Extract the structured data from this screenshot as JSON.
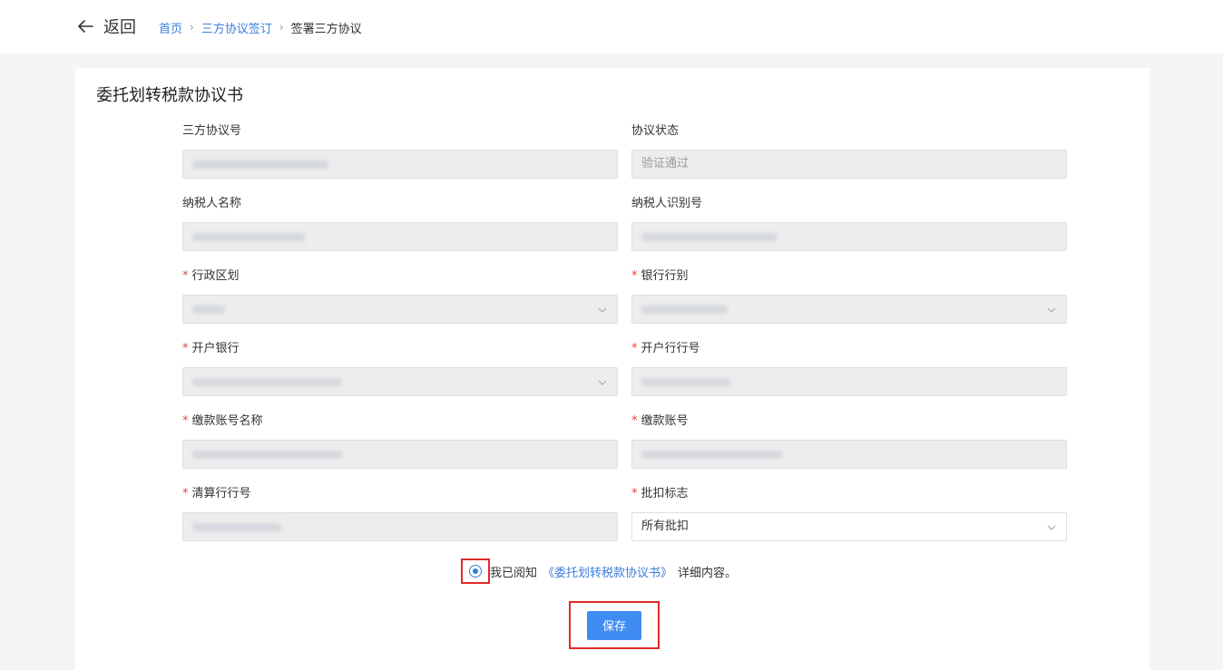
{
  "header": {
    "back_label": "返回",
    "breadcrumb": {
      "home": "首页",
      "section": "三方协议签订",
      "current": "签署三方协议"
    }
  },
  "form": {
    "title": "委托划转税款协议书",
    "fields": [
      {
        "label": "三方协议号",
        "required": false,
        "value": "",
        "type": "text",
        "editable": false
      },
      {
        "label": "协议状态",
        "required": false,
        "value": "验证通过",
        "type": "text",
        "editable": false
      },
      {
        "label": "纳税人名称",
        "required": false,
        "value": "",
        "type": "text",
        "editable": false
      },
      {
        "label": "纳税人识别号",
        "required": false,
        "value": "",
        "type": "text",
        "editable": false
      },
      {
        "label": "行政区划",
        "required": true,
        "value": "",
        "type": "select",
        "editable": false
      },
      {
        "label": "银行行别",
        "required": true,
        "value": "",
        "type": "select",
        "editable": false
      },
      {
        "label": "开户银行",
        "required": true,
        "value": "",
        "type": "select",
        "editable": false
      },
      {
        "label": "开户行行号",
        "required": true,
        "value": "",
        "type": "text",
        "editable": false
      },
      {
        "label": "缴款账号名称",
        "required": true,
        "value": "",
        "type": "text",
        "editable": false
      },
      {
        "label": "缴款账号",
        "required": true,
        "value": "",
        "type": "text",
        "editable": false
      },
      {
        "label": "清算行行号",
        "required": true,
        "value": "",
        "type": "text",
        "editable": false
      },
      {
        "label": "批扣标志",
        "required": true,
        "value": "所有批扣",
        "type": "select",
        "editable": true
      }
    ],
    "agreement": {
      "prefix": "我已阅知",
      "link": "《委托划转税款协议书》",
      "suffix": "详细内容。",
      "checked": true
    },
    "save_label": "保存"
  },
  "colors": {
    "accent": "#3b7ddd",
    "button": "#3f8cf3",
    "required": "#e0483e",
    "highlight": "#e02a2a",
    "disabled_bg": "#ededed"
  }
}
